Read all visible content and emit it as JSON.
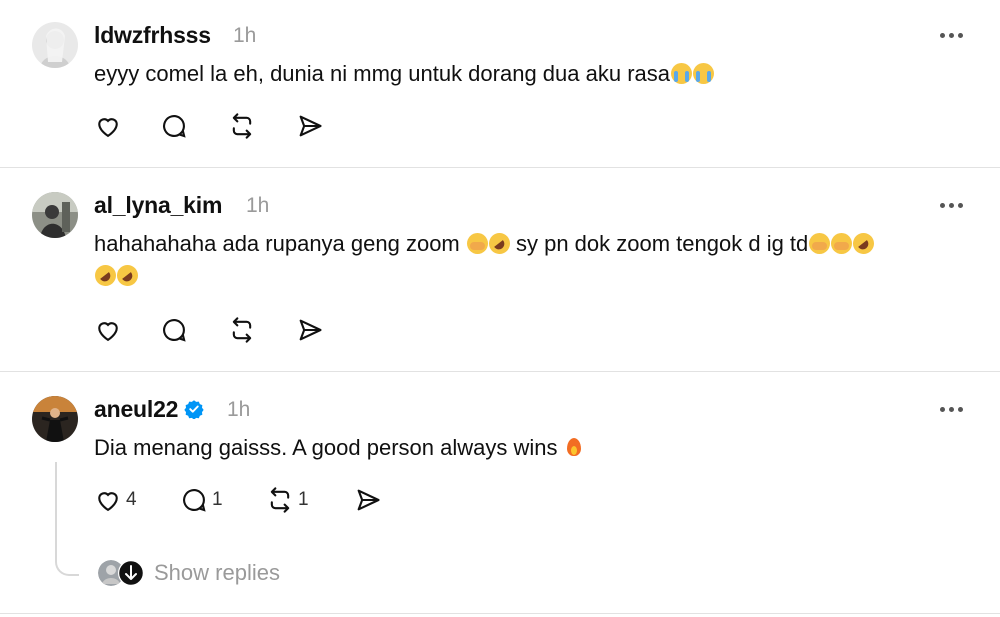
{
  "posts": [
    {
      "username": "ldwzfrhsss",
      "time": "1h",
      "text_line1": "eyyy comel la eh, dunia ni mmg untuk dorang dua aku rasa",
      "emojis_line1": [
        "loudly-crying-face",
        "loudly-crying-face"
      ]
    },
    {
      "username": "al_lyna_kim",
      "time": "1h",
      "text_part1": "hahahahaha ada rupanya geng zoom ",
      "text_part2": " sy pn dok zoom tengok d ig td",
      "emojis_line2": [
        "rolling-laughing-face",
        "rolling-laughing-face"
      ]
    },
    {
      "username": "aneul22",
      "verified": true,
      "time": "1h",
      "text": "Dia menang gaisss. A good person always wins ",
      "emoji": "fire",
      "counts": {
        "likes": "4",
        "replies": "1",
        "reposts": "1"
      },
      "show_replies": "Show replies"
    }
  ],
  "colors": {
    "verified": "#0095f6",
    "muted": "#9a9a9a",
    "divider": "#e2e2e2"
  },
  "icons": [
    "heart-icon",
    "comment-icon",
    "repost-icon",
    "share-icon",
    "more-icon"
  ]
}
